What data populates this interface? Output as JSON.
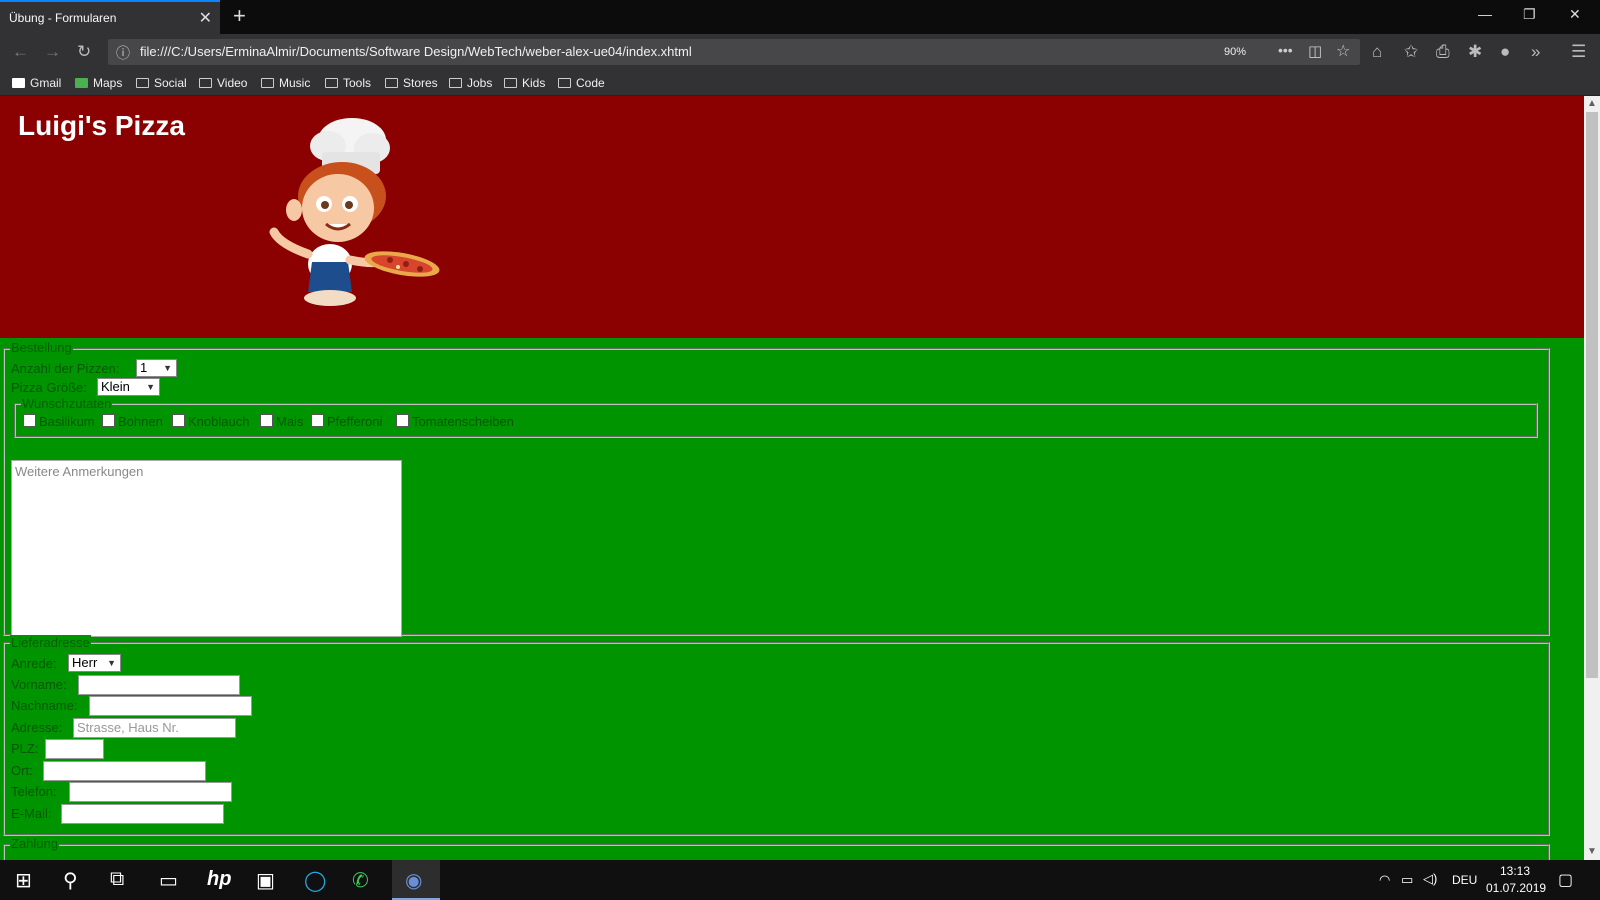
{
  "browser": {
    "tab_title": "Übung - Formularen",
    "close_tab": "✕",
    "new_tab": "+",
    "url": "file:///C:/Users/ErminaAlmir/Documents/Software Design/WebTech/weber-alex-ue04/index.xhtml",
    "zoom": "90%",
    "bookmarks": [
      "Gmail",
      "Maps",
      "Social",
      "Video",
      "Music",
      "Tools",
      "Stores",
      "Jobs",
      "Kids",
      "Code"
    ]
  },
  "page": {
    "title": "Luigi's Pizza",
    "bestellung": {
      "legend": "Bestellung",
      "anzahl_label": "Anzahl der Pizzen:",
      "anzahl_value": "1",
      "groesse_label": "Pizza Größe:",
      "groesse_value": "Klein",
      "wunsch_legend": "Wunschzutaten",
      "toppings": [
        "Basilikum",
        "Bohnen",
        "Knoblauch",
        "Mais",
        "Pfefferoni",
        "Tomatenscheiben"
      ],
      "notes_placeholder": "Weitere Anmerkungen"
    },
    "lieferadresse": {
      "legend": "Lieferadresse",
      "anrede_label": "Anrede:",
      "anrede_value": "Herr",
      "vorname_label": "Vorname:",
      "nachname_label": "Nachname:",
      "adresse_label": "Adresse:",
      "adresse_placeholder": "Strasse, Haus Nr.",
      "plz_label": "PLZ:",
      "ort_label": "Ort:",
      "telefon_label": "Telefon:",
      "email_label": "E-Mail:"
    },
    "zahlung_legend": "Zahlung"
  },
  "taskbar": {
    "language": "DEU",
    "time": "13:13",
    "date": "01.07.2019"
  }
}
